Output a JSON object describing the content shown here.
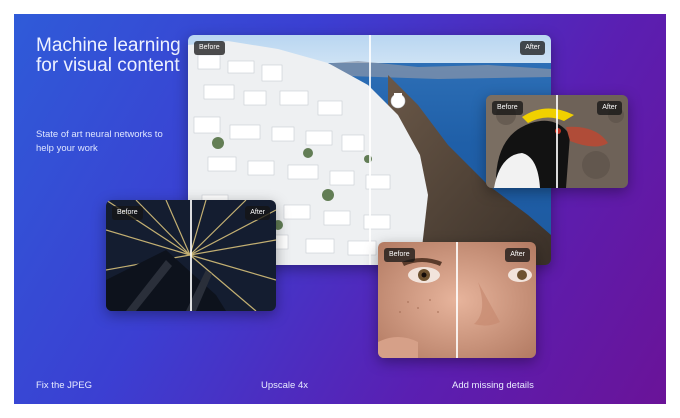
{
  "hero": {
    "headline": "Machine learning for visual content",
    "subtitle": "State of art neural networks to help your work"
  },
  "comparison_tags": {
    "before": "Before",
    "after": "After"
  },
  "features": [
    {
      "label": "Fix the JPEG"
    },
    {
      "label": "Upscale 4x"
    },
    {
      "label": "Add missing details"
    }
  ],
  "colors": {
    "gradient_start": "#2f5bd8",
    "gradient_end": "#6a1398",
    "tag_background": "#141414",
    "text": "#eef2ff"
  }
}
